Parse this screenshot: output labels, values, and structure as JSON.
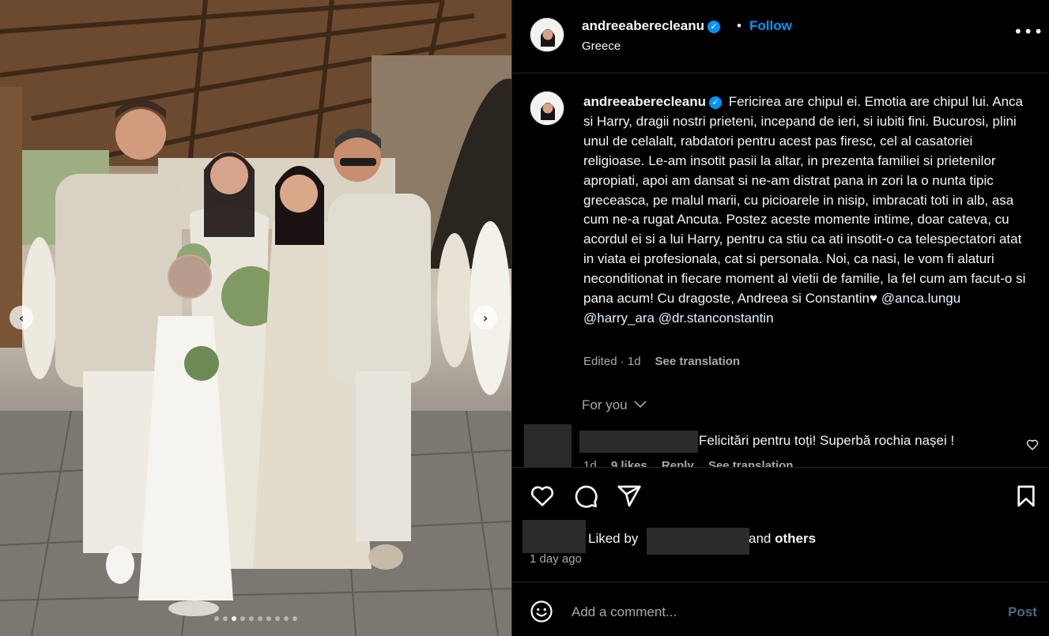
{
  "post": {
    "username": "andreeaberecleanu",
    "verified": true,
    "bullet": "•",
    "follow_label": "Follow",
    "location": "Greece",
    "more_label": "•••"
  },
  "media": {
    "prev_label": "‹",
    "next_label": "›",
    "dot_count": 10,
    "active_dot": 2
  },
  "caption": {
    "username": "andreeaberecleanu",
    "text": "Fericirea are chipul ei. Emotia are chipul lui. Anca si Harry, dragii nostri prieteni, incepand de ieri, si iubiti fini. Bucurosi, plini unul de celalalt, rabdatori pentru acest pas firesc, cel al casatoriei religioase. Le-am insotit pasii la altar, in prezenta familiei si prietenilor apropiati, apoi am dansat si ne-am distrat pana in zori la o nunta tipic greceasca, pe malul marii, cu picioarele in nisip, imbracati toti in alb, asa cum ne-a rugat Ancuta. Postez aceste momente intime, doar cateva, cu acordul ei si a lui Harry, pentru ca stiu ca ati insotit-o ca telespectatori atat in viata ei profesionala, cat si personala. Noi, ca nasi, le vom fi alaturi neconditionat in fiecare moment al vietii de familie, la fel cum am facut-o si pana acum! Cu dragoste, Andreea si Constantin♥",
    "mentions": [
      "@anca.lungu",
      "@harry_ara",
      "@dr.stanconstantin"
    ],
    "edited": "Edited · 1d",
    "see_translation": "See translation"
  },
  "for_you": "For you",
  "comment": {
    "text": "Felicitări pentru toți! Superbă rochia nașei !",
    "time": "1d",
    "likes": "9 likes",
    "reply": "Reply",
    "see_translation": "See translation"
  },
  "likes": {
    "liked_by": "Liked by",
    "and": "and",
    "others": "others",
    "time_ago": "1 day ago"
  },
  "add_comment": {
    "placeholder": "Add a comment...",
    "post_label": "Post"
  },
  "icons": [
    "heart-icon",
    "comment-icon",
    "share-icon",
    "bookmark-icon",
    "emoji-icon",
    "verified-icon",
    "more-icon"
  ],
  "colors": {
    "accent": "#0095f6",
    "background": "#000000",
    "muted": "#a8a8a8",
    "post_disabled": "#4b6a85"
  }
}
